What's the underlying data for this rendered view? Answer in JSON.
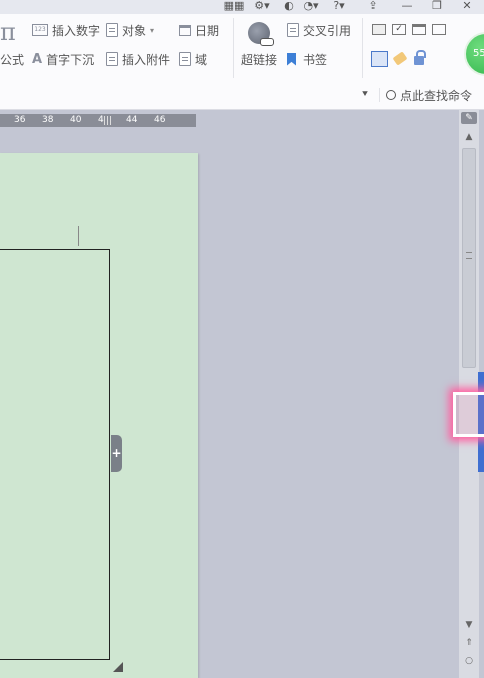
{
  "titlebar": {
    "icons": [
      "grid-icon",
      "settings-icon",
      "shield-icon",
      "help-icon",
      "upload-icon",
      "minimize-icon",
      "restore-icon",
      "close-icon"
    ]
  },
  "ribbon": {
    "pi_symbol": "π",
    "formula_label": "公式",
    "insert_number": "插入数字",
    "object_label": "对象",
    "date_label": "日期",
    "dropcap_label": "首字下沉",
    "insert_attachment": "插入附件",
    "field_label": "域",
    "hyperlink_label": "超链接",
    "crossref_label": "交叉引用",
    "bookmark_label": "书签",
    "search_label": "点此查找命令",
    "badge_value": "55"
  },
  "ruler": {
    "numbers": [
      "36",
      "38",
      "40",
      "4",
      "44",
      "46"
    ]
  },
  "page": {
    "add_symbol": "+"
  },
  "colors": {
    "page_bg": "#cfe6d1",
    "workspace_bg": "#c3c6d3",
    "accent_pink": "#ff5fa0",
    "badge_green": "#2fb44a"
  }
}
